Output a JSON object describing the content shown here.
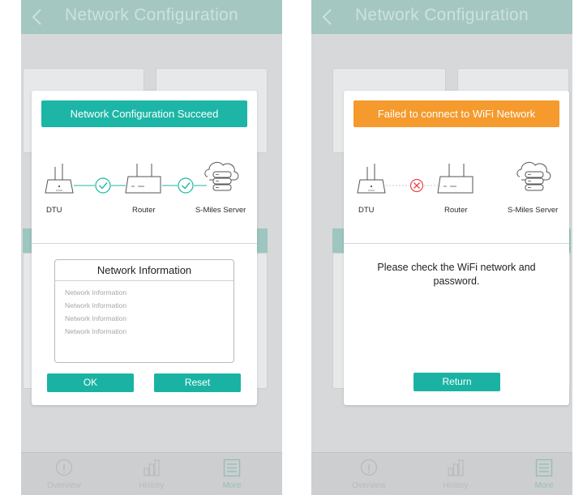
{
  "colors": {
    "accent": "#1ab3a3",
    "success_banner": "#1db6a6",
    "fail_banner": "#f59a2c",
    "error_icon": "#e8474b",
    "header_dimmed": "#a5c7c1"
  },
  "screens": [
    {
      "header": {
        "title": "Network Configuration",
        "back_icon": "chevron-left-icon"
      },
      "dialog": {
        "banner": "Network Configuration Succeed",
        "nodes": [
          "DTU",
          "Router",
          "S-Miles Server"
        ],
        "links": [
          "connected",
          "connected"
        ],
        "info": {
          "title": "Network Information",
          "lines": [
            "Network Information",
            "Network Information",
            "Network Information",
            "Network Information"
          ]
        },
        "buttons": {
          "ok": "OK",
          "reset": "Reset"
        }
      },
      "tabs": [
        {
          "label": "Overview",
          "icon": "info-icon",
          "active": false
        },
        {
          "label": "History",
          "icon": "bar-chart-icon",
          "active": false
        },
        {
          "label": "More",
          "icon": "menu-icon",
          "active": true
        }
      ]
    },
    {
      "header": {
        "title": "Network Configuration",
        "back_icon": "chevron-left-icon"
      },
      "dialog": {
        "banner": "Failed to connect to WiFi Network",
        "nodes": [
          "DTU",
          "Router",
          "S-Miles Server"
        ],
        "links": [
          "failed"
        ],
        "message": "Please check the WiFi network and password.",
        "buttons": {
          "return": "Return"
        }
      },
      "tabs": [
        {
          "label": "Overview",
          "icon": "info-icon",
          "active": false
        },
        {
          "label": "History",
          "icon": "bar-chart-icon",
          "active": false
        },
        {
          "label": "More",
          "icon": "menu-icon",
          "active": true
        }
      ]
    }
  ]
}
